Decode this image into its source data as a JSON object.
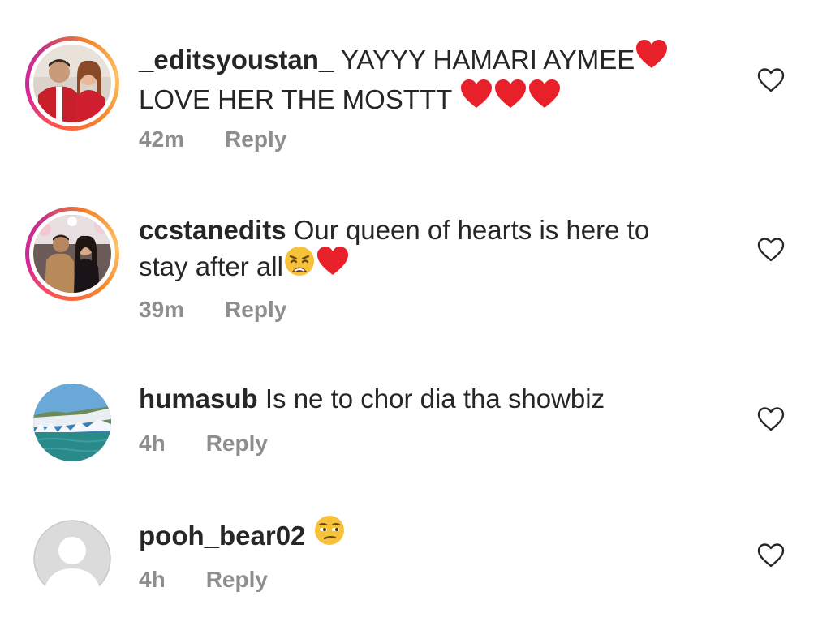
{
  "comments": [
    {
      "username": "_editsyoustan_",
      "text_line1": " YAYYY HAMARI AYMEE",
      "text_line2": "LOVE HER THE MOSTTT ",
      "time": "42m",
      "reply_label": "Reply",
      "avatar": "couple-photo-red"
    },
    {
      "username": "ccstanedits",
      "text_line1": " Our queen of hearts is here to",
      "text_line2": "stay after all",
      "time": "39m",
      "reply_label": "Reply",
      "avatar": "couple-photo-event"
    },
    {
      "username": "humasub",
      "text_line1": " Is ne to chor dia tha showbiz",
      "time": "4h",
      "reply_label": "Reply",
      "avatar": "waterfall-photo"
    },
    {
      "username": "pooh_bear02",
      "text_line1": " ",
      "time": "4h",
      "reply_label": "Reply",
      "avatar": "default-avatar"
    }
  ],
  "icons": {
    "like": "heart-outline-icon",
    "red_heart": "red-heart-emoji",
    "weary": "weary-face-emoji",
    "unamused": "unamused-face-emoji"
  },
  "colors": {
    "text": "#262626",
    "meta": "#8e8e8e",
    "heart_red": "#e8202a",
    "emoji_yellow": "#f7c23a"
  }
}
